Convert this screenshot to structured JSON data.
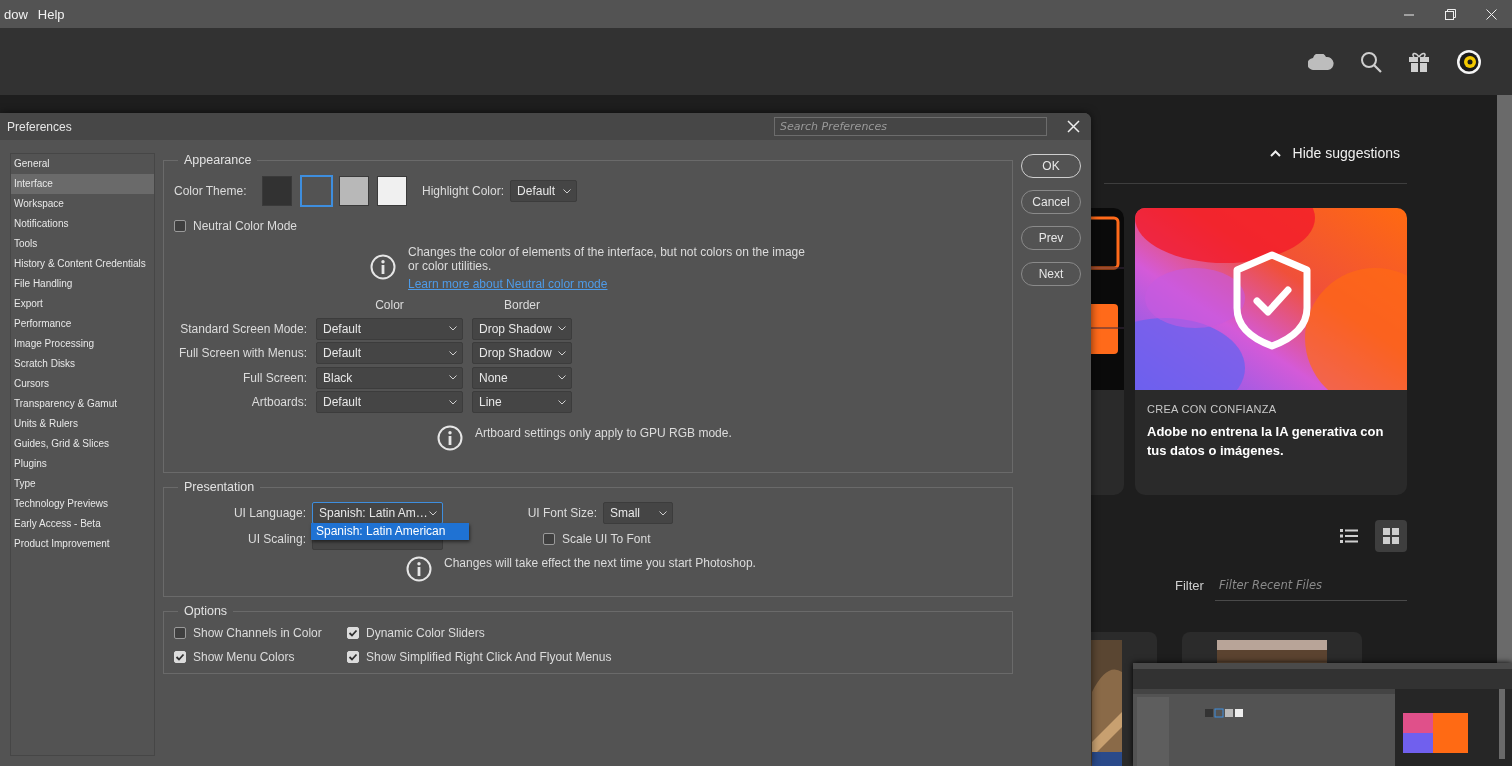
{
  "menu_bar": {
    "items": [
      "dow",
      "Help"
    ]
  },
  "home": {
    "hide_suggestions": "Hide suggestions",
    "card": {
      "eyebrow": "CREA CON CONFIANZA",
      "headline": "Adobe no entrena la IA generativa con tus datos o imágenes."
    },
    "view_toggle": [
      {
        "kind": "list",
        "selected": false
      },
      {
        "kind": "grid",
        "selected": true
      }
    ],
    "filter": {
      "label": "Filter",
      "placeholder": "Filter Recent Files"
    }
  },
  "dialog": {
    "title": "Preferences",
    "search_placeholder": "Search Preferences",
    "sidebar": [
      {
        "label": "General",
        "selected": false
      },
      {
        "label": "Interface",
        "selected": true
      },
      {
        "label": "Workspace",
        "selected": false
      },
      {
        "label": "Notifications",
        "selected": false
      },
      {
        "label": "Tools",
        "selected": false
      },
      {
        "label": "History & Content Credentials",
        "selected": false
      },
      {
        "label": "File Handling",
        "selected": false
      },
      {
        "label": "Export",
        "selected": false
      },
      {
        "label": "Performance",
        "selected": false
      },
      {
        "label": "Image Processing",
        "selected": false
      },
      {
        "label": "Scratch Disks",
        "selected": false
      },
      {
        "label": "Cursors",
        "selected": false
      },
      {
        "label": "Transparency & Gamut",
        "selected": false
      },
      {
        "label": "Units & Rulers",
        "selected": false
      },
      {
        "label": "Guides, Grid & Slices",
        "selected": false
      },
      {
        "label": "Plugins",
        "selected": false
      },
      {
        "label": "Type",
        "selected": false
      },
      {
        "label": "Technology Previews",
        "selected": false
      },
      {
        "label": "Early Access - Beta",
        "selected": false
      },
      {
        "label": "Product Improvement",
        "selected": false
      }
    ],
    "appearance": {
      "title": "Appearance",
      "color_theme_label": "Color Theme:",
      "swatches": [
        {
          "color": "#323232",
          "selected": false
        },
        {
          "color": "#535353",
          "selected": true
        },
        {
          "color": "#b8b8b8",
          "selected": false
        },
        {
          "color": "#f0f0f0",
          "selected": false
        }
      ],
      "highlight": {
        "label": "Highlight Color:",
        "value": "Default"
      },
      "neutral": {
        "label": "Neutral Color Mode",
        "checked": false
      },
      "info": {
        "text": "Changes the color of elements of the interface, but not colors on the image or color utilities.",
        "link": "Learn more about Neutral color mode"
      },
      "columns": [
        "Color",
        "Border"
      ],
      "screen_modes": [
        {
          "label": "Standard Screen Mode:",
          "color_setting": "Default",
          "border": "Drop Shadow"
        },
        {
          "label": "Full Screen with Menus:",
          "color_setting": "Default",
          "border": "Drop Shadow"
        },
        {
          "label": "Full Screen:",
          "color_setting": "Black",
          "border": "None"
        },
        {
          "label": "Artboards:",
          "color_setting": "Default",
          "border": "Line"
        }
      ],
      "artboard_note": "Artboard settings only apply to GPU RGB mode."
    },
    "presentation": {
      "title": "Presentation",
      "language": {
        "label": "UI Language:",
        "value": "Spanish: Latin Am…",
        "options": [
          {
            "label": "Spanish: Latin American",
            "selected": true
          }
        ]
      },
      "scaling": {
        "label": "UI Scaling:"
      },
      "font_size": {
        "label": "UI Font Size:",
        "value": "Small"
      },
      "scale_to_font": {
        "label": "Scale UI To Font",
        "checked": false
      },
      "note": "Changes will take effect the next time you start Photoshop."
    },
    "options": {
      "title": "Options",
      "items": [
        {
          "label": "Show Channels in Color",
          "checked": false
        },
        {
          "label": "Dynamic Color Sliders",
          "checked": true
        },
        {
          "label": "Show Menu Colors",
          "checked": true
        },
        {
          "label": "Show Simplified Right Click And Flyout Menus",
          "checked": true
        }
      ]
    },
    "buttons": [
      {
        "label": "OK",
        "default": true
      },
      {
        "label": "Cancel",
        "default": false
      },
      {
        "label": "Prev",
        "default": false
      },
      {
        "label": "Next",
        "default": false
      }
    ]
  }
}
